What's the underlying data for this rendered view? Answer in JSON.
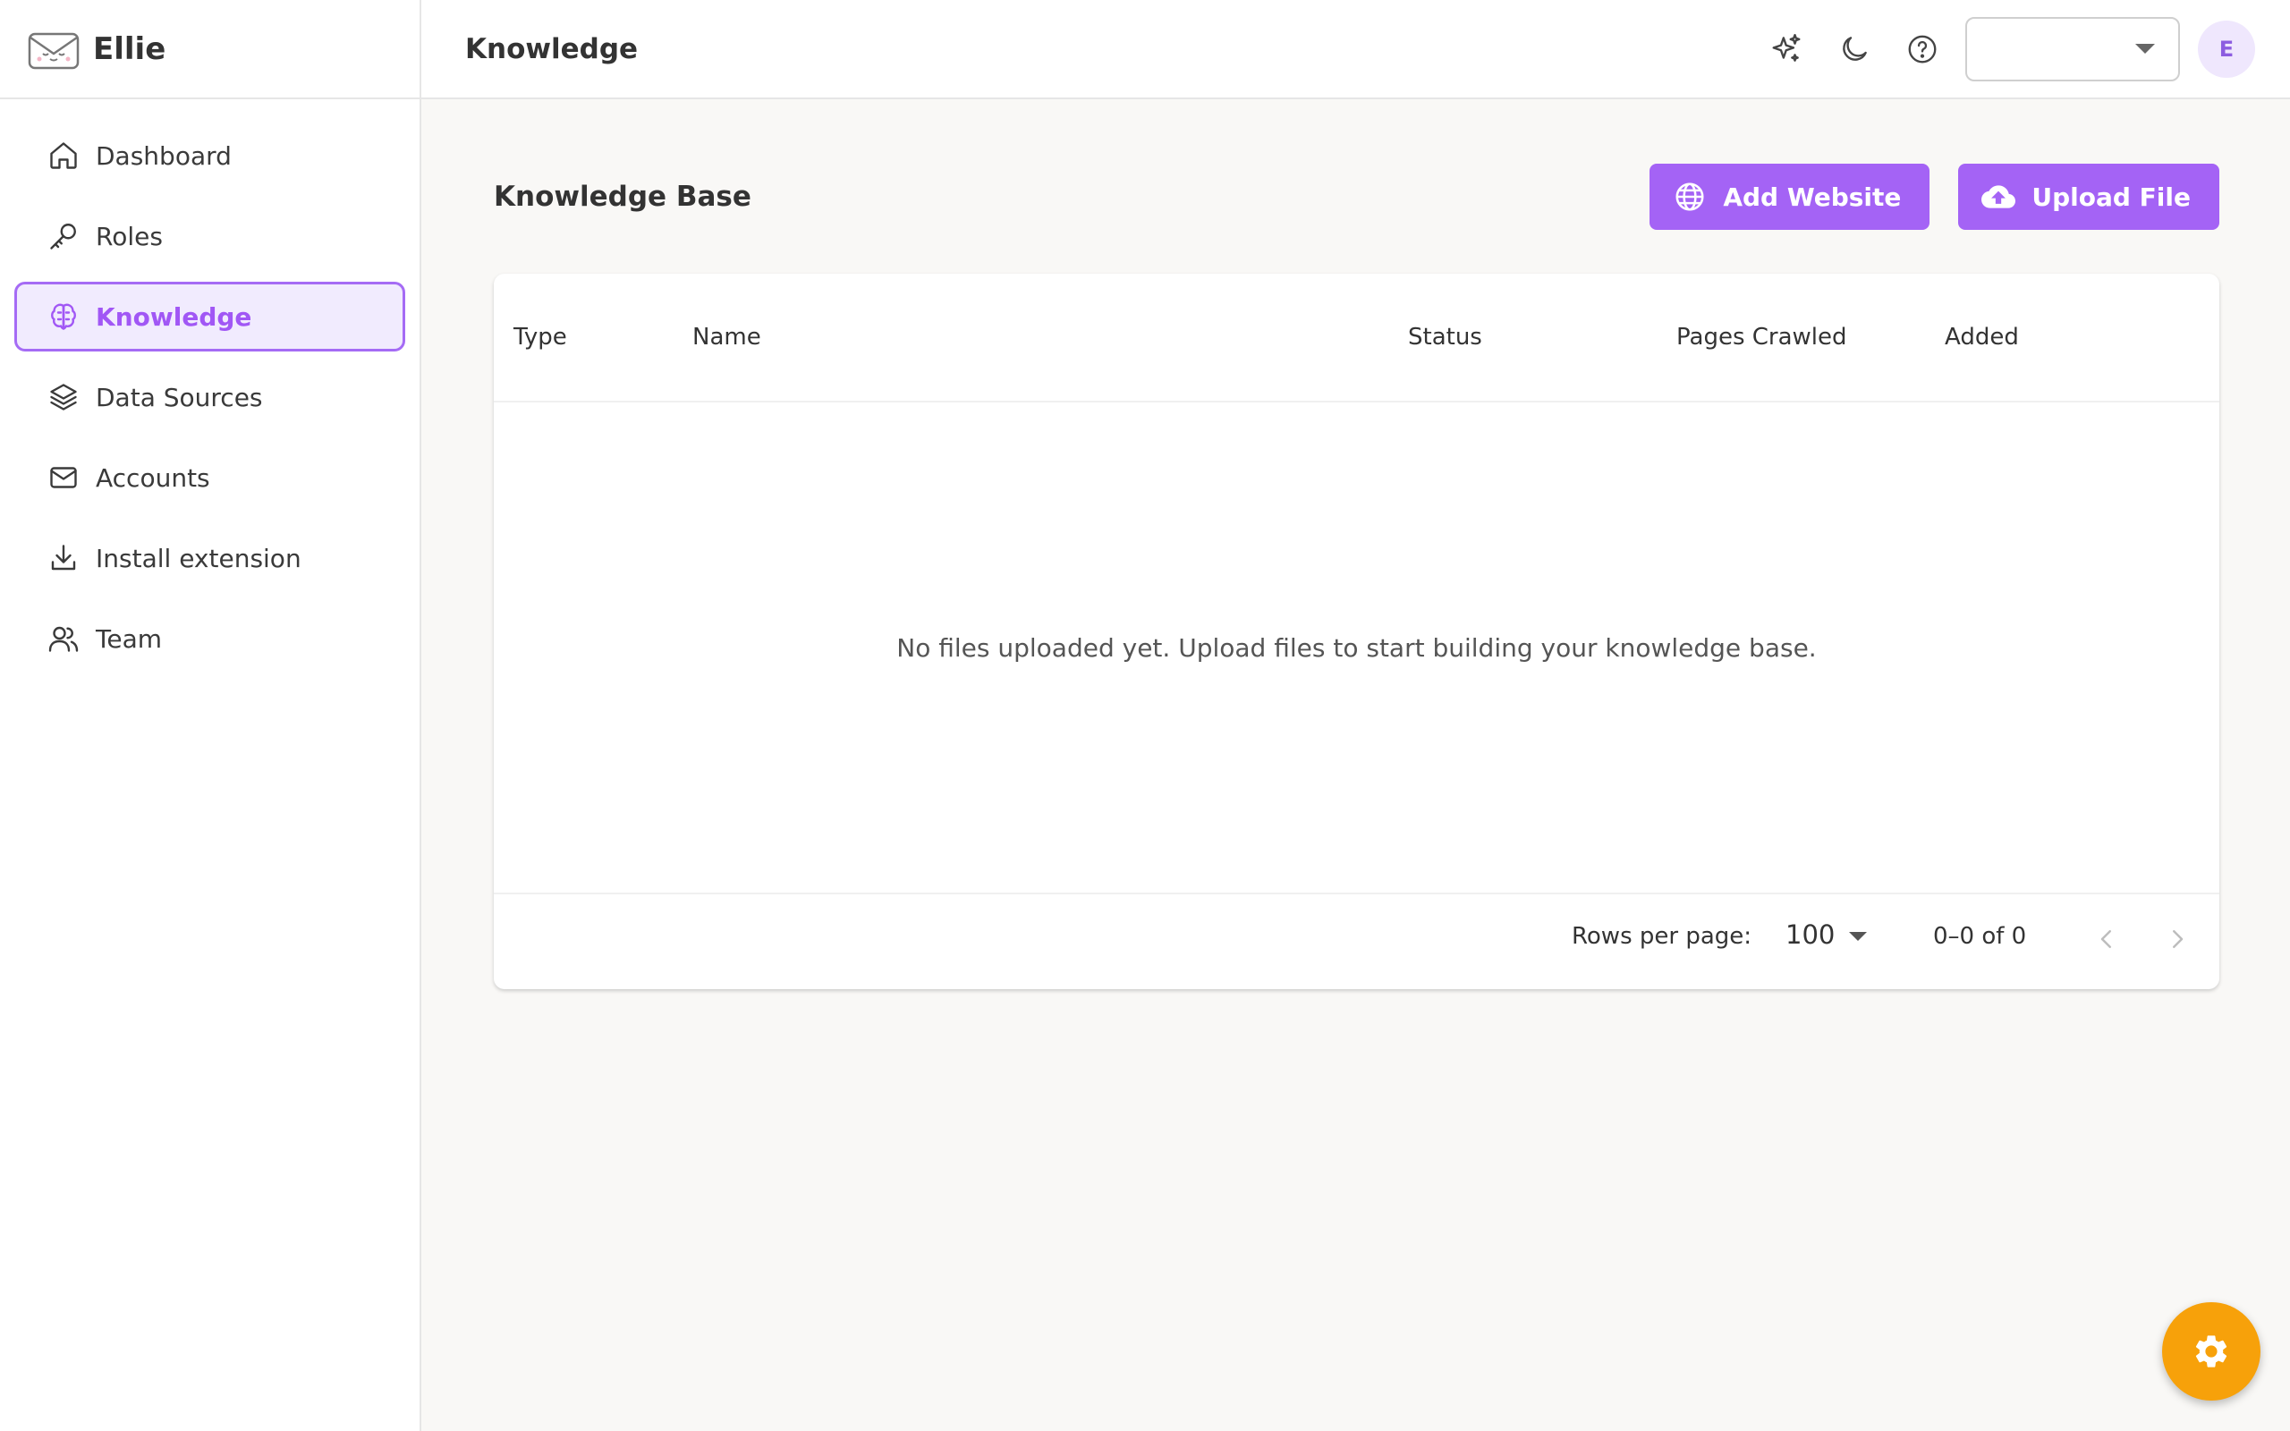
{
  "brand": {
    "name": "Ellie",
    "logo_icon": "envelope-face-icon"
  },
  "sidebar": {
    "items": [
      {
        "label": "Dashboard",
        "icon": "home-icon",
        "active": false
      },
      {
        "label": "Roles",
        "icon": "key-icon",
        "active": false
      },
      {
        "label": "Knowledge",
        "icon": "brain-icon",
        "active": true
      },
      {
        "label": "Data Sources",
        "icon": "layers-icon",
        "active": false
      },
      {
        "label": "Accounts",
        "icon": "mail-icon",
        "active": false
      },
      {
        "label": "Install extension",
        "icon": "download-icon",
        "active": false
      },
      {
        "label": "Team",
        "icon": "users-icon",
        "active": false
      }
    ]
  },
  "header": {
    "title": "Knowledge",
    "icons": [
      "sparkles-icon",
      "moon-icon",
      "help-circle-icon"
    ],
    "select_value": "",
    "avatar_initial": "E"
  },
  "main": {
    "title": "Knowledge Base",
    "add_website_label": "Add Website",
    "upload_file_label": "Upload File",
    "table": {
      "columns": [
        "Type",
        "Name",
        "Status",
        "Pages Crawled",
        "Added"
      ],
      "rows": [],
      "empty_message": "No files uploaded yet. Upload files to start building your knowledge base."
    },
    "pagination": {
      "rows_per_page_label": "Rows per page:",
      "rows_per_page": "100",
      "range": "0–0 of 0"
    }
  },
  "fab": {
    "icon": "gear-icon"
  },
  "colors": {
    "accent": "#a463f5",
    "accent_light": "#f1ebfe",
    "fab": "#f7a10a",
    "background": "#f9f8f6"
  }
}
